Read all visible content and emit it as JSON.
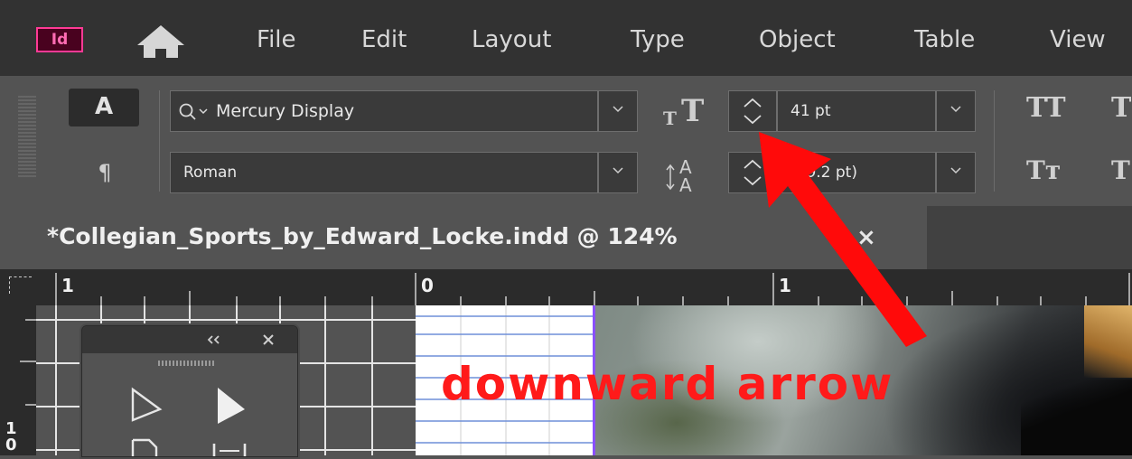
{
  "menubar": {
    "app_logo": "Id",
    "menu": [
      "File",
      "Edit",
      "Layout",
      "Type",
      "Object",
      "Table",
      "View"
    ]
  },
  "control_panel": {
    "char_mode": "A",
    "para_mode": "¶",
    "font_family": "Mercury Display",
    "font_style": "Roman",
    "font_size": "41 pt",
    "leading": "(49.2 pt)",
    "all_caps_label": "TT",
    "small_caps_label": "Tт"
  },
  "document_tab": {
    "title": "*Collegian_Sports_by_Edward_Locke.indd @ 124%",
    "close": "×"
  },
  "rulers": {
    "h_labels": [
      "1",
      "0",
      "1"
    ],
    "v_labels": [
      "1",
      "0"
    ]
  },
  "annotation": {
    "text": "downward arrow"
  },
  "colors": {
    "accent_indesign": "#ff3a95",
    "annotation_red": "#ff1a1a",
    "page_edge": "#8a4fff",
    "guide_blue": "#6e8fd8"
  },
  "icons": {
    "home": "home-icon",
    "search": "search-icon",
    "font_size": "font-size-icon",
    "leading": "leading-icon",
    "spinner": "spinner-icon",
    "selection_tool": "selection-tool-icon",
    "direct_selection_tool": "direct-selection-tool-icon"
  }
}
